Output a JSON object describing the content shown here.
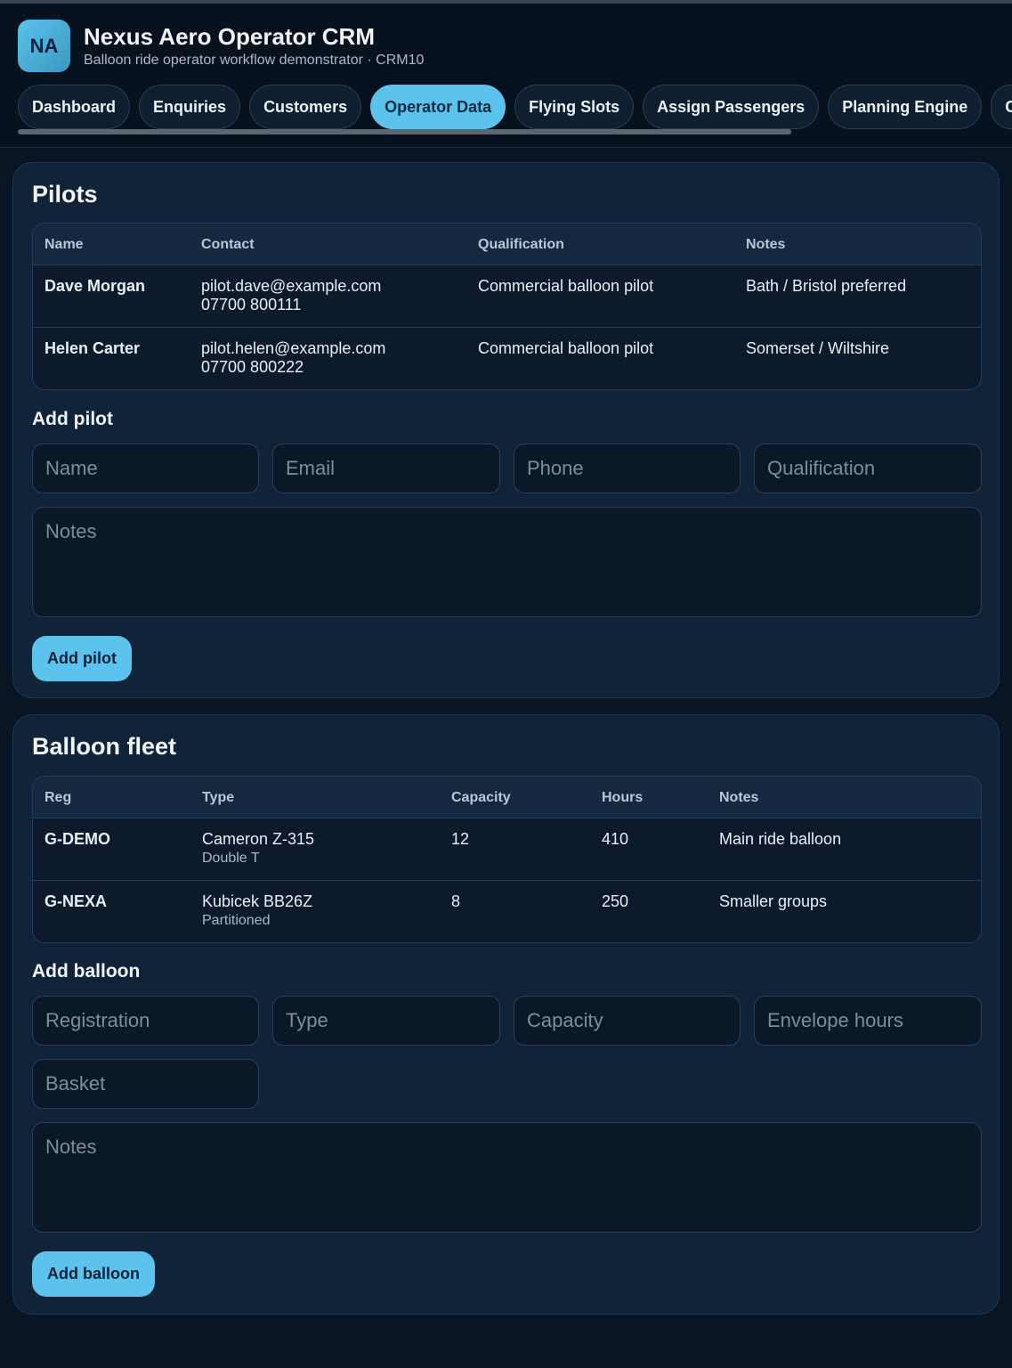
{
  "app": {
    "logo_initials": "NA",
    "title": "Nexus Aero Operator CRM",
    "subtitle": "Balloon ride operator workflow demonstrator · CRM10"
  },
  "tabs": [
    {
      "label": "Dashboard",
      "active": false
    },
    {
      "label": "Enquiries",
      "active": false
    },
    {
      "label": "Customers",
      "active": false
    },
    {
      "label": "Operator Data",
      "active": true
    },
    {
      "label": "Flying Slots",
      "active": false
    },
    {
      "label": "Assign Passengers",
      "active": false
    },
    {
      "label": "Planning Engine",
      "active": false
    },
    {
      "label": "C",
      "active": false
    }
  ],
  "pilots": {
    "title": "Pilots",
    "columns": [
      "Name",
      "Contact",
      "Qualification",
      "Notes"
    ],
    "rows": [
      {
        "name": "Dave Morgan",
        "email": "pilot.dave@example.com",
        "phone": "07700 800111",
        "qualification": "Commercial balloon pilot",
        "notes": "Bath / Bristol preferred"
      },
      {
        "name": "Helen Carter",
        "email": "pilot.helen@example.com",
        "phone": "07700 800222",
        "qualification": "Commercial balloon pilot",
        "notes": "Somerset / Wiltshire"
      }
    ],
    "add_title": "Add pilot",
    "placeholders": {
      "name": "Name",
      "email": "Email",
      "phone": "Phone",
      "qualification": "Qualification",
      "notes": "Notes"
    },
    "add_button": "Add pilot"
  },
  "fleet": {
    "title": "Balloon fleet",
    "columns": [
      "Reg",
      "Type",
      "Capacity",
      "Hours",
      "Notes"
    ],
    "rows": [
      {
        "reg": "G-DEMO",
        "type": "Cameron Z-315",
        "basket": "Double T",
        "capacity": "12",
        "hours": "410",
        "notes": "Main ride balloon"
      },
      {
        "reg": "G-NEXA",
        "type": "Kubicek BB26Z",
        "basket": "Partitioned",
        "capacity": "8",
        "hours": "250",
        "notes": "Smaller groups"
      }
    ],
    "add_title": "Add balloon",
    "placeholders": {
      "registration": "Registration",
      "type": "Type",
      "capacity": "Capacity",
      "hours": "Envelope hours",
      "basket": "Basket",
      "notes": "Notes"
    },
    "add_button": "Add balloon"
  },
  "colors": {
    "accent": "#5cc4ec",
    "background": "#0a1523",
    "card": "#102339"
  }
}
